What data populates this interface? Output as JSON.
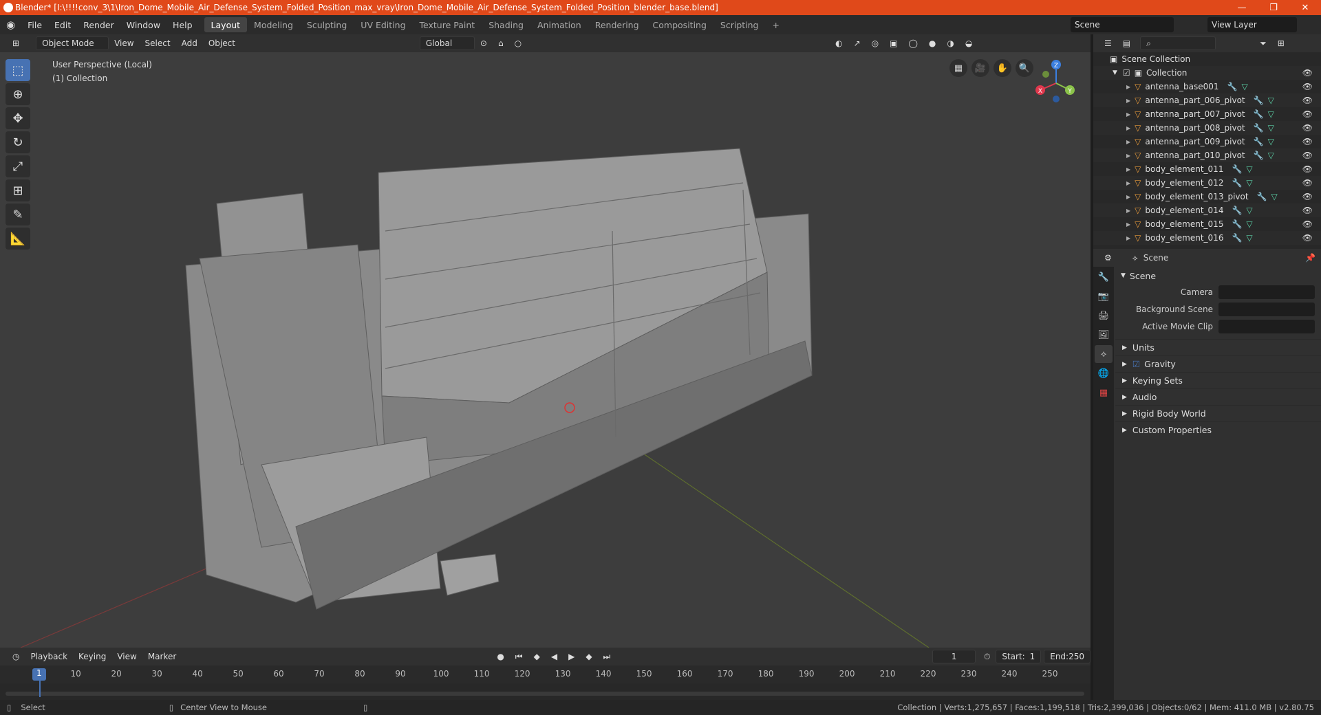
{
  "window": {
    "title": "Blender* [I:\\!!!!conv_3\\1\\Iron_Dome_Mobile_Air_Defense_System_Folded_Position_max_vray\\Iron_Dome_Mobile_Air_Defense_System_Folded_Position_blender_base.blend]",
    "minimize": "—",
    "maximize": "❐",
    "close": "✕"
  },
  "menu": {
    "items": [
      "File",
      "Edit",
      "Render",
      "Window",
      "Help"
    ],
    "workspaces": [
      "Layout",
      "Modeling",
      "Sculpting",
      "UV Editing",
      "Texture Paint",
      "Shading",
      "Animation",
      "Rendering",
      "Compositing",
      "Scripting"
    ],
    "add_workspace": "+",
    "scene": "Scene",
    "view_layer": "View Layer"
  },
  "viewport_header": {
    "mode": "Object Mode",
    "menus": [
      "View",
      "Select",
      "Add",
      "Object"
    ],
    "orientation": "Global"
  },
  "viewport": {
    "perspective": "User Perspective (Local)",
    "collection": "(1) Collection",
    "gizmo": {
      "x": "X",
      "y": "Y",
      "z": "Z"
    }
  },
  "outliner": {
    "root": "Scene Collection",
    "collection": "Collection",
    "items": [
      "antenna_base001",
      "antenna_part_006_pivot",
      "antenna_part_007_pivot",
      "antenna_part_008_pivot",
      "antenna_part_009_pivot",
      "antenna_part_010_pivot",
      "body_element_011",
      "body_element_012",
      "body_element_013_pivot",
      "body_element_014",
      "body_element_015",
      "body_element_016"
    ]
  },
  "properties": {
    "context": "Scene",
    "panel": "Scene",
    "rows": [
      {
        "label": "Camera"
      },
      {
        "label": "Background Scene"
      },
      {
        "label": "Active Movie Clip"
      }
    ],
    "subpanels": [
      {
        "label": "Units",
        "checkbox": false
      },
      {
        "label": "Gravity",
        "checkbox": true
      },
      {
        "label": "Keying Sets",
        "checkbox": false
      },
      {
        "label": "Audio",
        "checkbox": false
      },
      {
        "label": "Rigid Body World",
        "checkbox": false
      },
      {
        "label": "Custom Properties",
        "checkbox": false
      }
    ]
  },
  "timeline": {
    "menus": [
      "Playback",
      "Keying",
      "View",
      "Marker"
    ],
    "current_frame": "1",
    "start_label": "Start:",
    "start": "1",
    "end_label": "End:",
    "end": "250",
    "ticks": [
      "1",
      "10",
      "20",
      "30",
      "40",
      "50",
      "60",
      "70",
      "80",
      "90",
      "100",
      "110",
      "120",
      "130",
      "140",
      "150",
      "160",
      "170",
      "180",
      "190",
      "200",
      "210",
      "220",
      "230",
      "240",
      "250"
    ]
  },
  "status": {
    "select": "Select",
    "center": "Center View to Mouse",
    "stats": "Collection | Verts:1,275,657 | Faces:1,199,518 | Tris:2,399,036 | Objects:0/62 | Mem: 411.0 MB | v2.80.75"
  }
}
